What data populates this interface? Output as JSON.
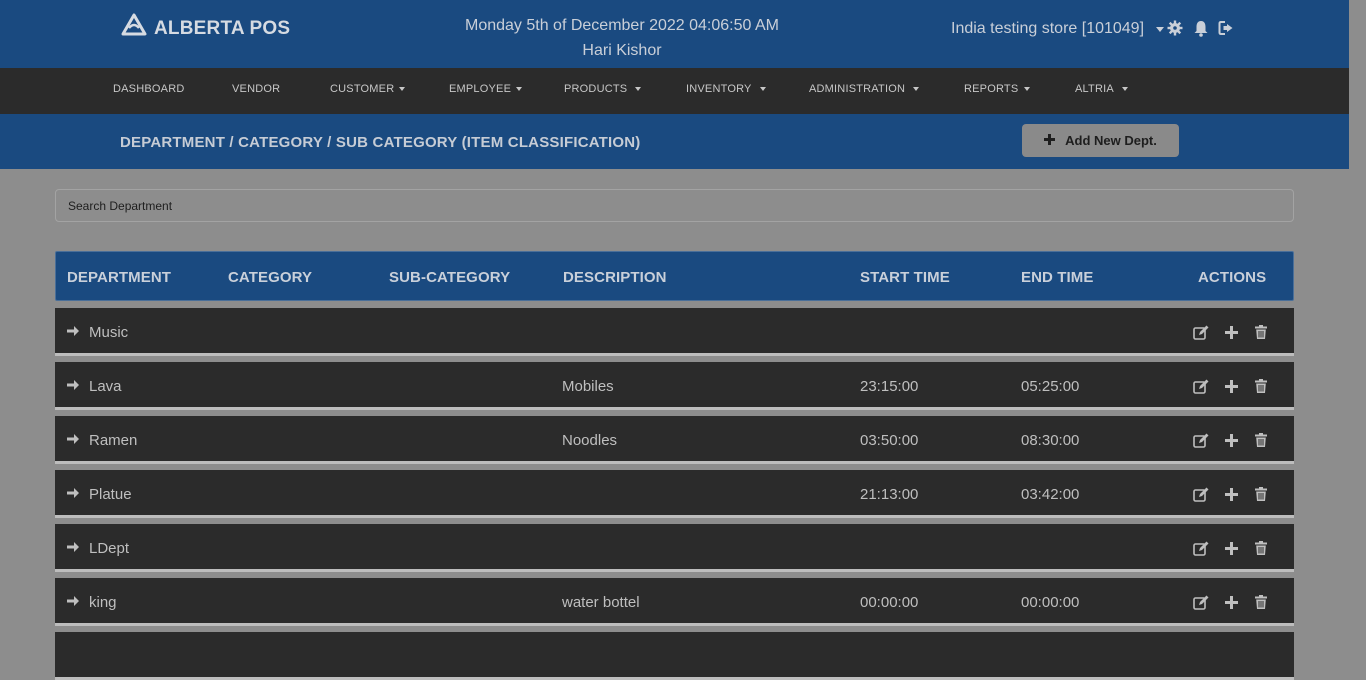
{
  "header": {
    "brand": "ALBERTA POS",
    "datetime": "Monday 5th of December 2022 04:06:50 AM",
    "user": "Hari Kishor",
    "store": "India testing store [101049]"
  },
  "nav": [
    {
      "label": "DASHBOARD",
      "dropdown": false
    },
    {
      "label": "VENDOR",
      "dropdown": false
    },
    {
      "label": "CUSTOMER",
      "dropdown": true
    },
    {
      "label": "EMPLOYEE",
      "dropdown": true
    },
    {
      "label": "PRODUCTS",
      "dropdown": true
    },
    {
      "label": "INVENTORY",
      "dropdown": true
    },
    {
      "label": "ADMINISTRATION",
      "dropdown": true
    },
    {
      "label": "REPORTS",
      "dropdown": true
    },
    {
      "label": "ALTRIA",
      "dropdown": true
    }
  ],
  "page": {
    "title": "DEPARTMENT / CATEGORY / SUB CATEGORY (ITEM CLASSIFICATION)",
    "add_label": "Add New Dept.",
    "search_placeholder": "Search Department"
  },
  "table": {
    "columns": [
      "DEPARTMENT",
      "CATEGORY",
      "SUB-CATEGORY",
      "DESCRIPTION",
      "START TIME",
      "END TIME",
      "ACTIONS"
    ],
    "rows": [
      {
        "department": "Music",
        "description": "",
        "start": "",
        "end": ""
      },
      {
        "department": "Lava",
        "description": "Mobiles",
        "start": "23:15:00",
        "end": "05:25:00"
      },
      {
        "department": "Ramen",
        "description": "Noodles",
        "start": "03:50:00",
        "end": "08:30:00"
      },
      {
        "department": "Platue",
        "description": "",
        "start": "21:13:00",
        "end": "03:42:00"
      },
      {
        "department": "LDept",
        "description": "",
        "start": "",
        "end": ""
      },
      {
        "department": "king",
        "description": "water bottel",
        "start": "00:00:00",
        "end": "00:00:00"
      }
    ]
  },
  "icons": {
    "logo": "alberta-logo-icon",
    "settings": "gear-icon",
    "notifications": "bell-icon",
    "logout": "sign-out-icon",
    "expand": "arrow-right-icon",
    "edit": "edit-icon",
    "add": "plus-icon",
    "delete": "trash-icon"
  },
  "colors": {
    "header_bg": "#1a4a80",
    "nav_bg": "#2b2b2b",
    "page_bg": "#8d8d8d"
  }
}
